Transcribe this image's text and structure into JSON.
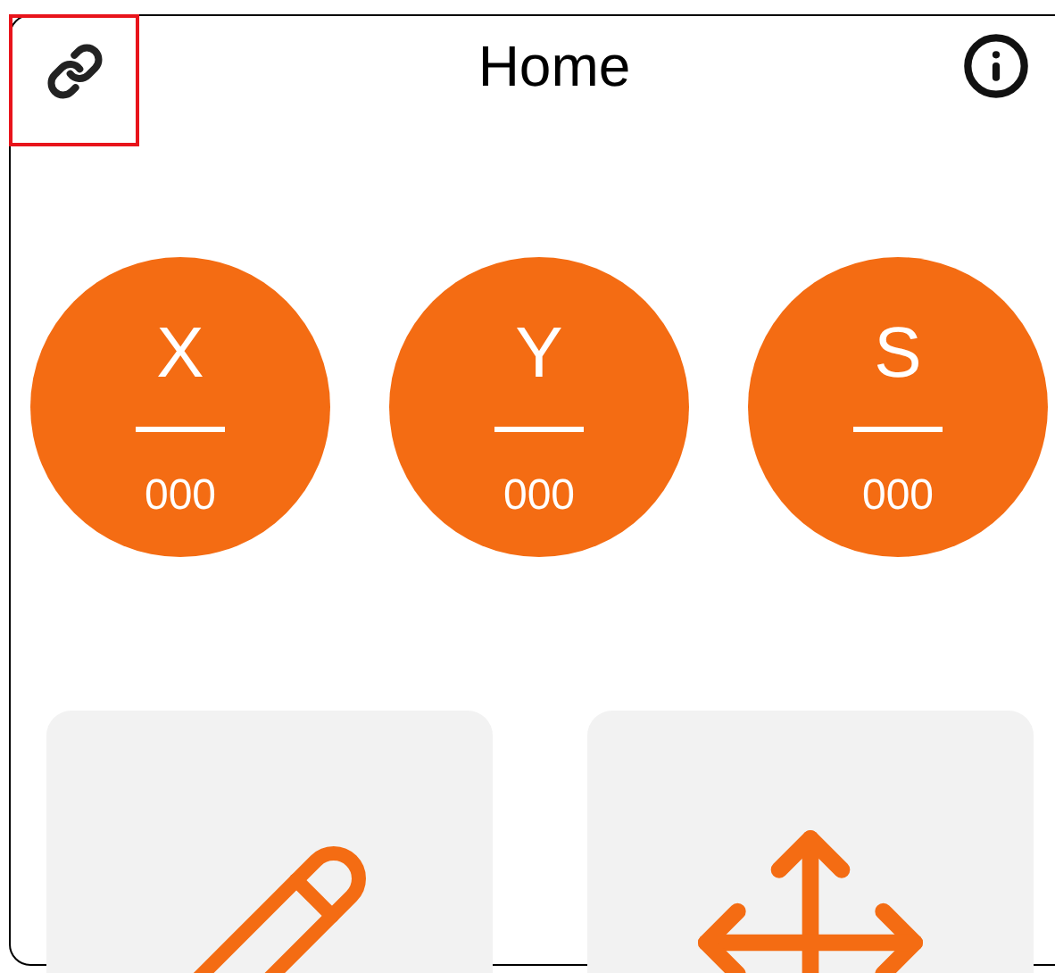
{
  "top_bar": {
    "title": "Home"
  },
  "counters": [
    {
      "label": "X",
      "value": "000"
    },
    {
      "label": "Y",
      "value": "000"
    },
    {
      "label": "S",
      "value": "000"
    }
  ],
  "tiles": [
    {
      "kind": "edit"
    },
    {
      "kind": "move"
    }
  ]
}
